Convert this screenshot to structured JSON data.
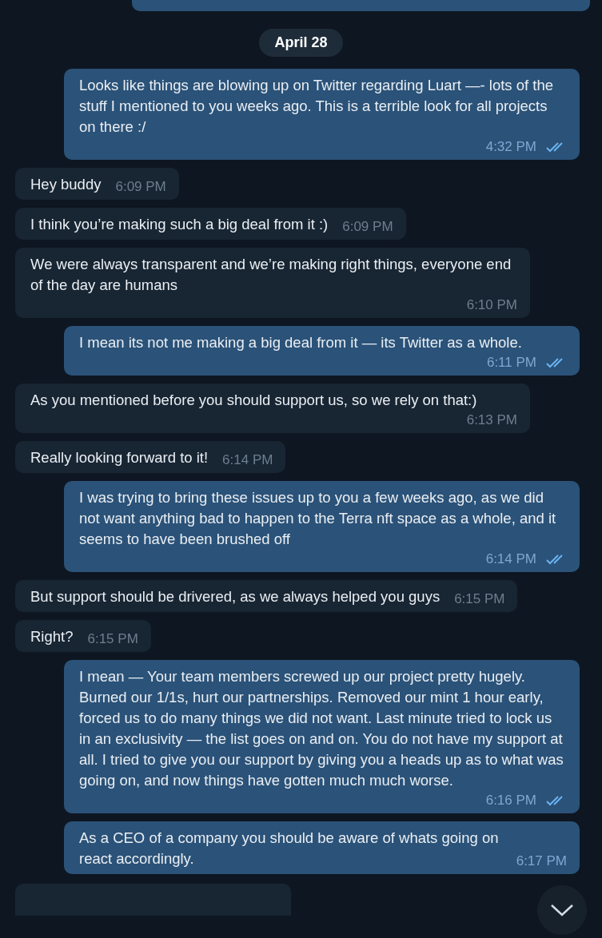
{
  "date_pill": "April 28",
  "messages": [
    {
      "kind": "out",
      "text": "Looks like things are blowing up on Twitter regarding Luart —- lots of the stuff I mentioned to you weeks ago. This is a terrible look for all projects on there :/",
      "time": "4:32 PM",
      "read": true
    },
    {
      "kind": "in",
      "text": "Hey buddy",
      "time": "6:09 PM"
    },
    {
      "kind": "in",
      "text": "I think you’re making such a big deal from it :)",
      "time": "6:09 PM"
    },
    {
      "kind": "in",
      "text": "We were always transparent and we’re making right things, everyone end of the day are humans",
      "time": "6:10 PM"
    },
    {
      "kind": "out",
      "text": "I mean its not me making a big deal from it — its Twitter as a whole.",
      "time": "6:11 PM",
      "read": true
    },
    {
      "kind": "in",
      "text": "As you mentioned before you should support us, so we rely on that:)",
      "time": "6:13 PM"
    },
    {
      "kind": "in",
      "text": "Really looking forward to it!",
      "time": "6:14 PM"
    },
    {
      "kind": "out",
      "text": "I was trying to bring these issues up to you a few weeks ago, as we did not want anything bad to happen to the Terra nft space as a whole, and it seems to have been brushed off",
      "time": "6:14 PM",
      "read": true
    },
    {
      "kind": "in",
      "text": "But support should be drivered, as we always helped you guys",
      "time": "6:15 PM"
    },
    {
      "kind": "in",
      "text": "Right?",
      "time": "6:15 PM"
    },
    {
      "kind": "out",
      "text": "I mean — Your team members screwed up our project pretty hugely. Burned our 1/1s, hurt our partnerships. Removed our mint 1 hour early, forced us to do many things we did not want. Last minute tried to lock us in an exclusivity — the list goes on and on. You do not have my support at all. I tried to give you our support by giving you a heads up as to what was going on, and now things have gotten much much worse.",
      "time": "6:16 PM",
      "read": true
    },
    {
      "kind": "out",
      "text": "As a CEO of a company you should be aware of whats going on",
      "text2": "react accordingly.",
      "time": "6:17 PM"
    }
  ]
}
